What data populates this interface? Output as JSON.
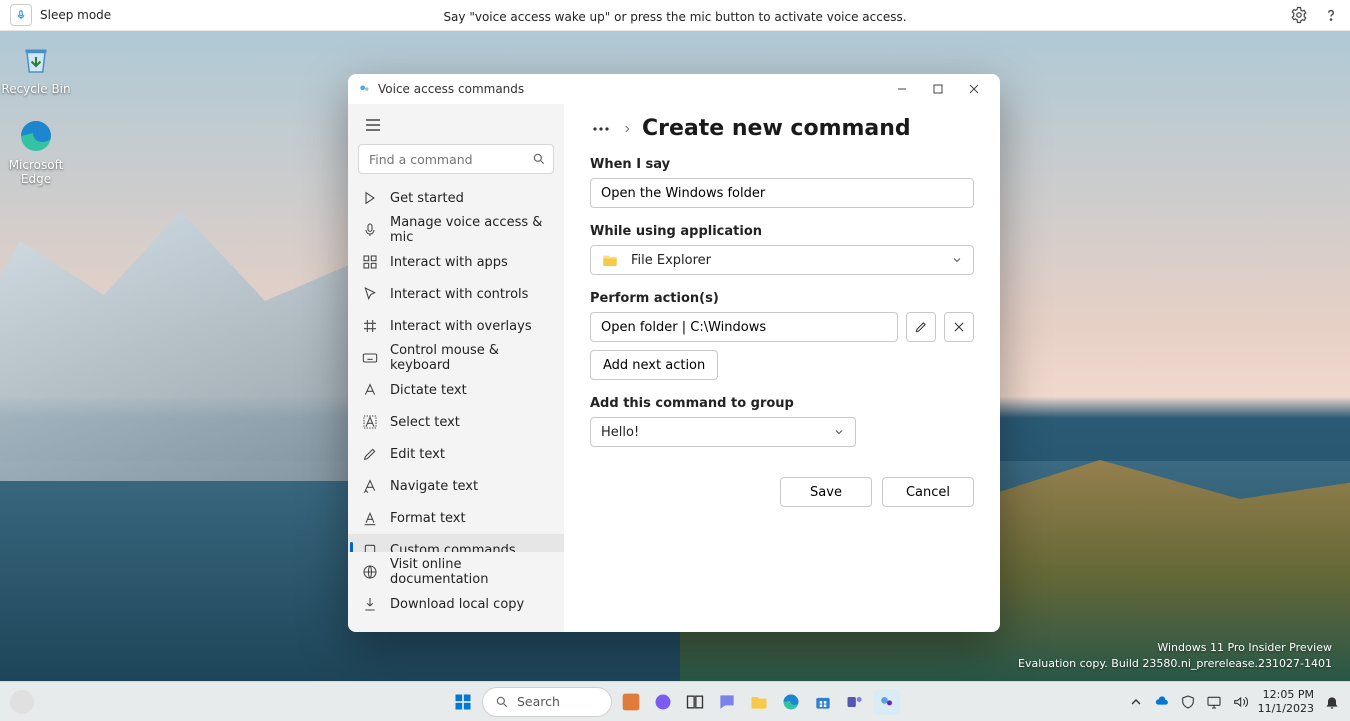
{
  "voice_bar": {
    "mode": "Sleep mode",
    "hint": "Say \"voice access wake up\" or press the mic button to activate voice access."
  },
  "desktop_icons": {
    "recycle_bin": "Recycle Bin",
    "edge": "Microsoft Edge"
  },
  "app": {
    "title": "Voice access commands",
    "search_placeholder": "Find a command",
    "nav": {
      "get_started": "Get started",
      "manage": "Manage voice access & mic",
      "apps": "Interact with apps",
      "controls": "Interact with controls",
      "overlays": "Interact with overlays",
      "mouse": "Control mouse & keyboard",
      "dictate": "Dictate text",
      "select": "Select text",
      "edit": "Edit text",
      "navigate": "Navigate text",
      "format": "Format text",
      "custom": "Custom commands"
    },
    "footer": {
      "docs": "Visit online documentation",
      "download": "Download local copy"
    },
    "page": {
      "title": "Create new command",
      "when_label": "When I say",
      "when_value": "Open the Windows folder",
      "app_label": "While using application",
      "app_value": "File Explorer",
      "actions_label": "Perform action(s)",
      "action_value": "Open folder | C:\\Windows",
      "add_action": "Add next action",
      "group_label": "Add this command to group",
      "group_value": "Hello!",
      "save": "Save",
      "cancel": "Cancel"
    }
  },
  "watermark": {
    "line1": "Windows 11 Pro Insider Preview",
    "line2": "Evaluation copy. Build 23580.ni_prerelease.231027-1401"
  },
  "taskbar": {
    "search": "Search",
    "time": "12:05 PM",
    "date": "11/1/2023"
  }
}
